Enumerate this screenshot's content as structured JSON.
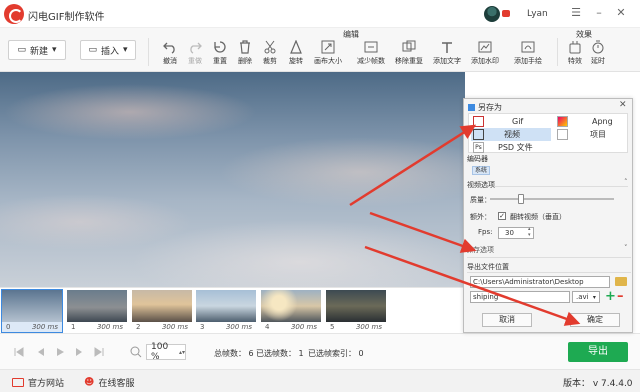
{
  "app": {
    "title": "闪电GIF制作软件",
    "user": "Lyan",
    "version": "版本： v 7.4.4.0"
  },
  "toolbar": {
    "new_label": "新建",
    "insert_label": "插入",
    "edit_section": "编辑",
    "effects_section": "效果",
    "tools": [
      {
        "label": "撤消",
        "icon": "undo-icon",
        "enabled": true
      },
      {
        "label": "重做",
        "icon": "redo-icon",
        "enabled": false
      },
      {
        "label": "重置",
        "icon": "reset-icon",
        "enabled": true
      },
      {
        "label": "删除",
        "icon": "trash-icon",
        "enabled": true
      },
      {
        "label": "裁剪",
        "icon": "scissors-icon",
        "enabled": true
      },
      {
        "label": "旋转",
        "icon": "rotate-icon",
        "enabled": true
      },
      {
        "label": "画布大小",
        "icon": "resize-icon",
        "enabled": true
      },
      {
        "label": "减少帧数",
        "icon": "reduce-frames-icon",
        "enabled": true
      },
      {
        "label": "移除重复",
        "icon": "remove-duplicate-icon",
        "enabled": true
      },
      {
        "label": "添加文字",
        "icon": "text-icon",
        "enabled": true
      },
      {
        "label": "添加水印",
        "icon": "watermark-icon",
        "enabled": true
      },
      {
        "label": "添加手绘",
        "icon": "draw-icon",
        "enabled": true
      },
      {
        "label": "特效",
        "icon": "effects-icon",
        "enabled": true
      },
      {
        "label": "延时",
        "icon": "delay-icon",
        "enabled": true
      }
    ]
  },
  "frames": [
    {
      "index": "0",
      "duration": "300 ms",
      "selected": true,
      "palette": "sky"
    },
    {
      "index": "1",
      "duration": "300 ms",
      "selected": false,
      "palette": "city-dusk"
    },
    {
      "index": "2",
      "duration": "300 ms",
      "selected": false,
      "palette": "city-sunset"
    },
    {
      "index": "3",
      "duration": "300 ms",
      "selected": false,
      "palette": "city-day"
    },
    {
      "index": "4",
      "duration": "300 ms",
      "selected": false,
      "palette": "city-warm"
    },
    {
      "index": "5",
      "duration": "300 ms",
      "selected": false,
      "palette": "city-night"
    }
  ],
  "status": {
    "zoom": "100 %",
    "total_frames": "总帧数： 6",
    "selected_frames": "已选帧数： 1",
    "selected_index": "已选帧索引： 0",
    "export_label": "导出"
  },
  "footer": {
    "website": "官方网站",
    "support": "在线客服"
  },
  "dialog": {
    "title": "另存为",
    "formats": [
      {
        "label": "Gif",
        "selected": false
      },
      {
        "label": "Apng",
        "selected": false
      },
      {
        "label": "视频",
        "selected": true
      },
      {
        "label": "项目",
        "selected": false
      },
      {
        "label": "PSD 文件",
        "selected": false
      }
    ],
    "encoder_label": "编码器",
    "encoder_value": "系统",
    "video_options_label": "视频选项",
    "quality_label": "质量：",
    "quality_value": 0.25,
    "extra_label": "额外：",
    "flip_label": "翻转视频（垂直）",
    "flip_checked": true,
    "fps_label": "Fps:",
    "fps_value": "30",
    "partial_label": "保存选项",
    "export_path_label": "导出文件位置",
    "path_value": "C:\\Users\\Administrator\\Desktop",
    "filename_value": "shiping",
    "extension_value": ".avi",
    "cancel_label": "取消",
    "ok_label": "确定"
  },
  "colors": {
    "accent_green": "#1eaa52",
    "arrow_red": "#e23b2e",
    "selection_blue": "#cfe1f5"
  }
}
